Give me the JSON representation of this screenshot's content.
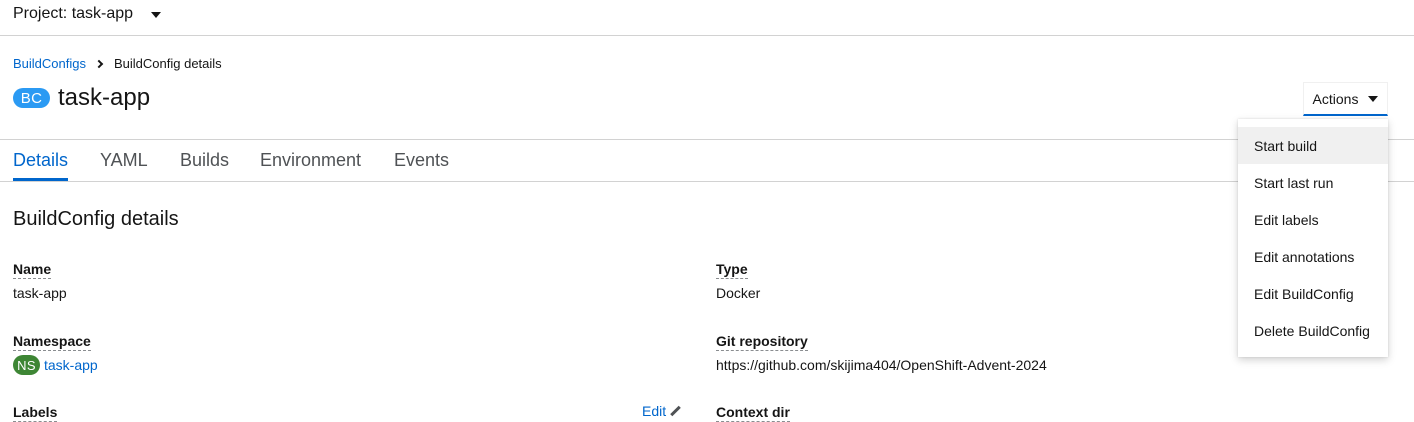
{
  "project": {
    "label": "Project: task-app"
  },
  "breadcrumb": {
    "parent": "BuildConfigs",
    "current": "BuildConfig details"
  },
  "header": {
    "badge": "BC",
    "title": "task-app",
    "actions_label": "Actions"
  },
  "tabs": [
    {
      "label": "Details",
      "active": true
    },
    {
      "label": "YAML"
    },
    {
      "label": "Builds"
    },
    {
      "label": "Environment"
    },
    {
      "label": "Events"
    }
  ],
  "details": {
    "section_title": "BuildConfig details",
    "name_label": "Name",
    "name_value": "task-app",
    "namespace_label": "Namespace",
    "namespace_badge": "NS",
    "namespace_value": "task-app",
    "labels_label": "Labels",
    "edit_label": "Edit",
    "type_label": "Type",
    "type_value": "Docker",
    "git_label": "Git repository",
    "git_value": "https://github.com/skijima404/OpenShift-Advent-2024",
    "context_label": "Context dir"
  },
  "actions_menu": {
    "items": [
      "Start build",
      "Start last run",
      "Edit labels",
      "Edit annotations",
      "Edit BuildConfig",
      "Delete BuildConfig"
    ]
  },
  "colors": {
    "link": "#0066cc",
    "bc_badge": "#2b9af3",
    "ns_badge": "#3e8635"
  }
}
